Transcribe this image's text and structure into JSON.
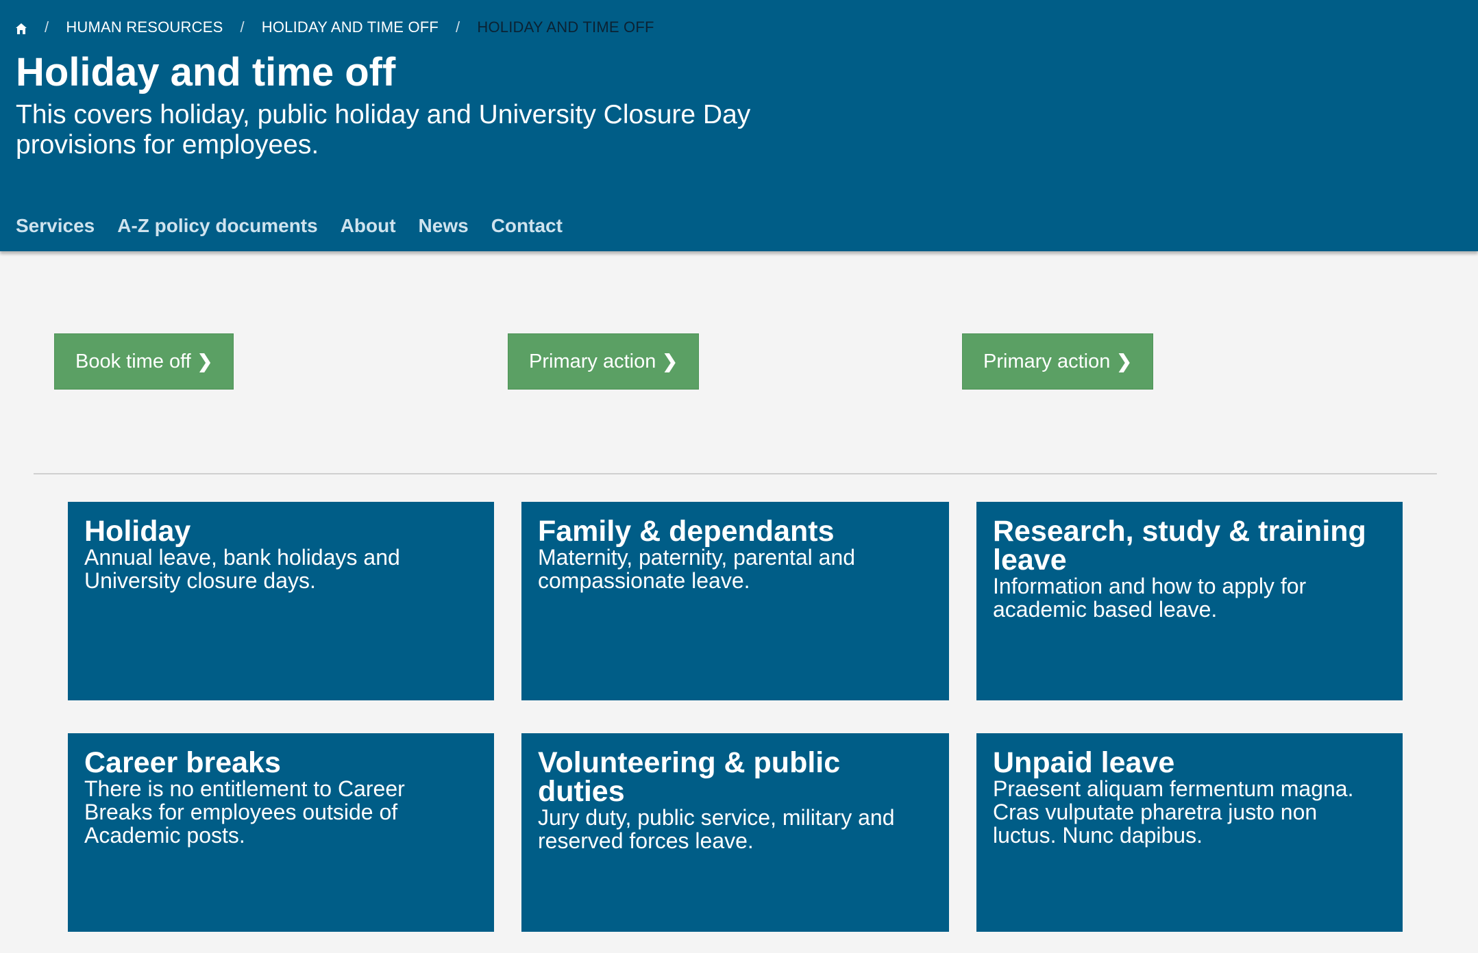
{
  "breadcrumb": {
    "home_icon": "home-icon",
    "separator": "/",
    "items": [
      "HUMAN RESOURCES",
      "HOLIDAY AND TIME OFF",
      "HOLIDAY AND TIME OFF"
    ]
  },
  "header": {
    "title": "Holiday and time off",
    "lede": "This covers holiday, public holiday and University Closure Day provisions for employees."
  },
  "nav": {
    "items": [
      "Services",
      "A-Z policy documents",
      "About",
      "News",
      "Contact"
    ]
  },
  "actions": {
    "chevron": "❯",
    "buttons": [
      "Book time off",
      "Primary action",
      "Primary action"
    ]
  },
  "cards": [
    {
      "title": "Holiday",
      "text": "Annual leave, bank holidays and University closure days."
    },
    {
      "title": "Family & dependants",
      "text": "Maternity, paternity, parental and compassionate leave."
    },
    {
      "title": "Research, study & training leave",
      "text": "Information and how to apply for academic based leave."
    },
    {
      "title": "Career breaks",
      "text": "There is no entitlement to Career Breaks for employees outside of Academic posts."
    },
    {
      "title": "Volunteering & public duties",
      "text": "Jury duty, public service, military and reserved forces leave."
    },
    {
      "title": "Unpaid leave",
      "text": "Praesent aliquam fermentum magna. Cras vulputate pharetra justo non luctus. Nunc dapibus."
    }
  ],
  "colors": {
    "brand_blue": "#005d87",
    "action_green": "#5ba064",
    "page_background": "#f4f4f4"
  }
}
